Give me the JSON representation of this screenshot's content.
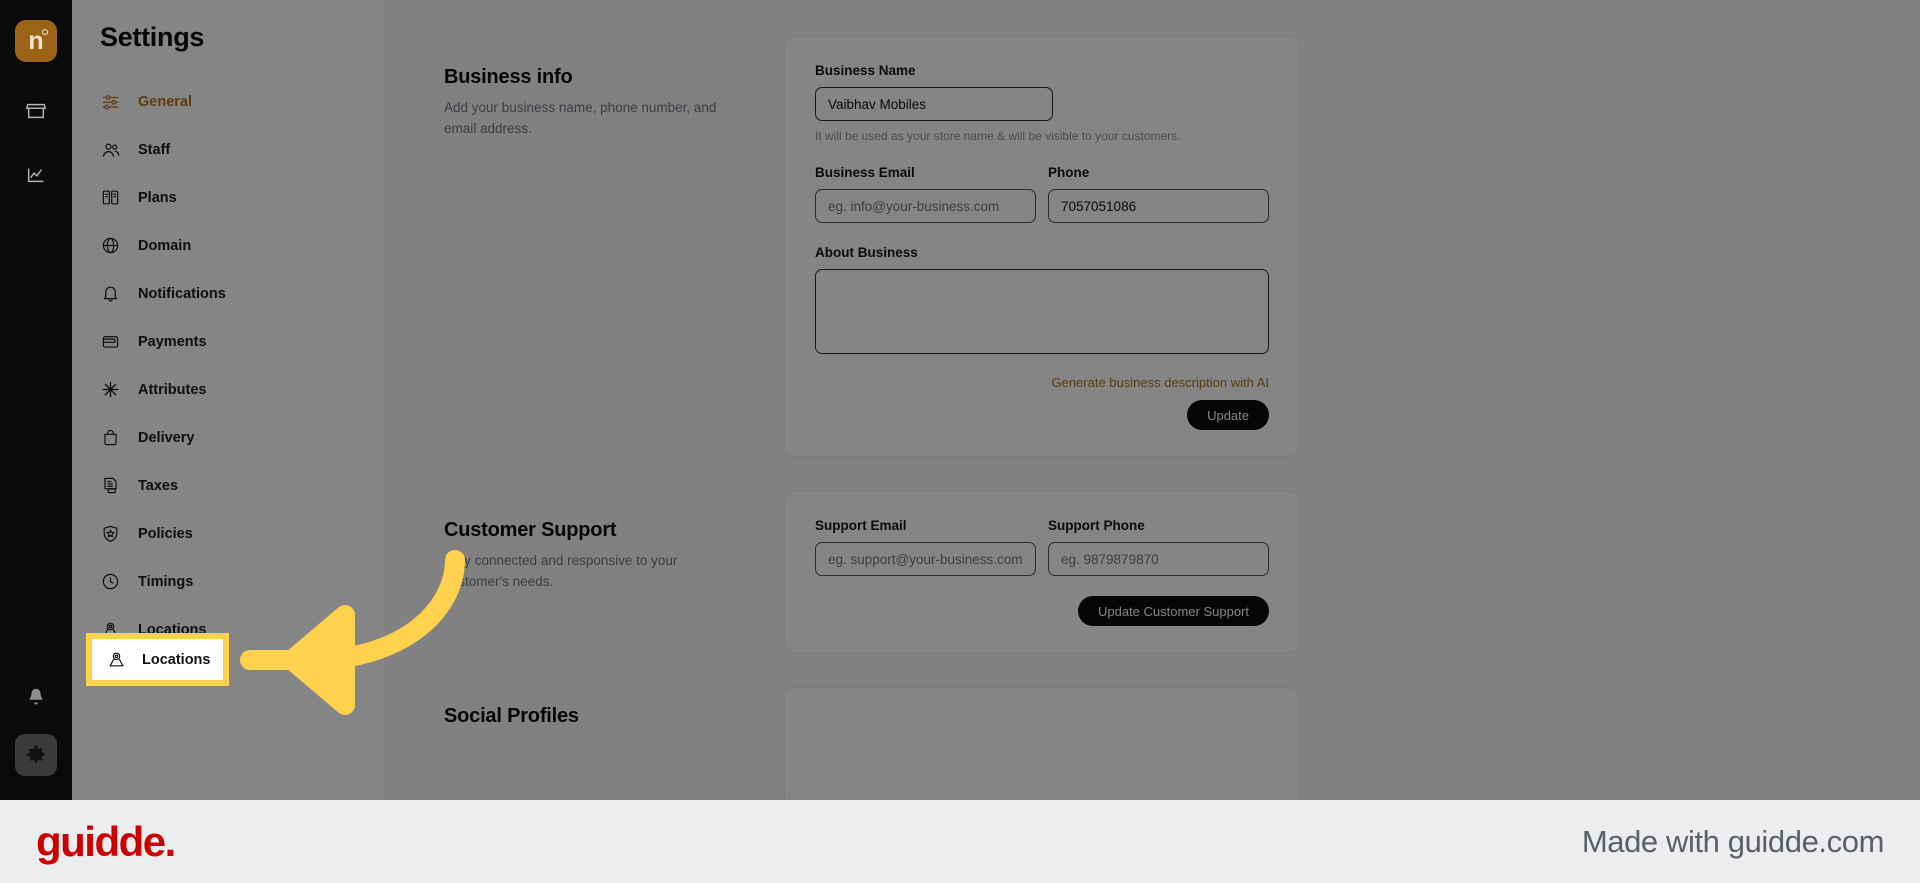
{
  "rail": {
    "logo_letter": "n",
    "icons": [
      {
        "name": "store-icon"
      },
      {
        "name": "analytics-icon"
      },
      {
        "name": "bell-icon"
      },
      {
        "name": "gear-icon"
      }
    ]
  },
  "sidebar": {
    "title": "Settings",
    "items": [
      {
        "label": "General",
        "icon": "sliders-icon",
        "active": true
      },
      {
        "label": "Staff",
        "icon": "people-icon",
        "active": false
      },
      {
        "label": "Plans",
        "icon": "plans-icon",
        "active": false
      },
      {
        "label": "Domain",
        "icon": "globe-icon",
        "active": false
      },
      {
        "label": "Notifications",
        "icon": "bell-icon",
        "active": false
      },
      {
        "label": "Payments",
        "icon": "wallet-icon",
        "active": false
      },
      {
        "label": "Attributes",
        "icon": "asterisk-icon",
        "active": false
      },
      {
        "label": "Delivery",
        "icon": "bag-icon",
        "active": false
      },
      {
        "label": "Taxes",
        "icon": "tax-document-icon",
        "active": false
      },
      {
        "label": "Policies",
        "icon": "shield-icon",
        "active": false
      },
      {
        "label": "Timings",
        "icon": "clock-icon",
        "active": false
      },
      {
        "label": "Locations",
        "icon": "location-pin-icon",
        "active": false
      }
    ]
  },
  "business_info": {
    "title": "Business info",
    "description": "Add your business name, phone number, and email address.",
    "business_name_label": "Business Name",
    "business_name_value": "Vaibhav Mobiles",
    "business_name_hint": "It will be used as your store name & will be visible to your customers.",
    "business_email_label": "Business Email",
    "business_email_placeholder": "eg. info@your-business.com",
    "business_email_value": "",
    "phone_label": "Phone",
    "phone_value": "7057051086",
    "about_label": "About Business",
    "about_value": "",
    "ai_link": "Generate business description with AI",
    "update_button": "Update"
  },
  "customer_support": {
    "title": "Customer Support",
    "description": "Stay connected and responsive to your customer's needs.",
    "support_email_label": "Support Email",
    "support_email_placeholder": "eg. support@your-business.com",
    "support_email_value": "",
    "support_phone_label": "Support Phone",
    "support_phone_placeholder": "eg. 9879879870",
    "support_phone_value": "",
    "update_button": "Update Customer Support"
  },
  "social_profiles": {
    "title": "Social Profiles"
  },
  "highlight": {
    "label": "Locations",
    "border_color": "#ffd24d",
    "arrow_color": "#ffd24d"
  },
  "footer": {
    "logo_text": "guidde.",
    "made_with": "Made with guidde.com",
    "logo_color": "#cc0000"
  },
  "colors": {
    "accent": "#b07219",
    "rail_bg": "#0b0b0b",
    "highlight": "#ffd24d",
    "button_dark": "#0c0c0c"
  }
}
